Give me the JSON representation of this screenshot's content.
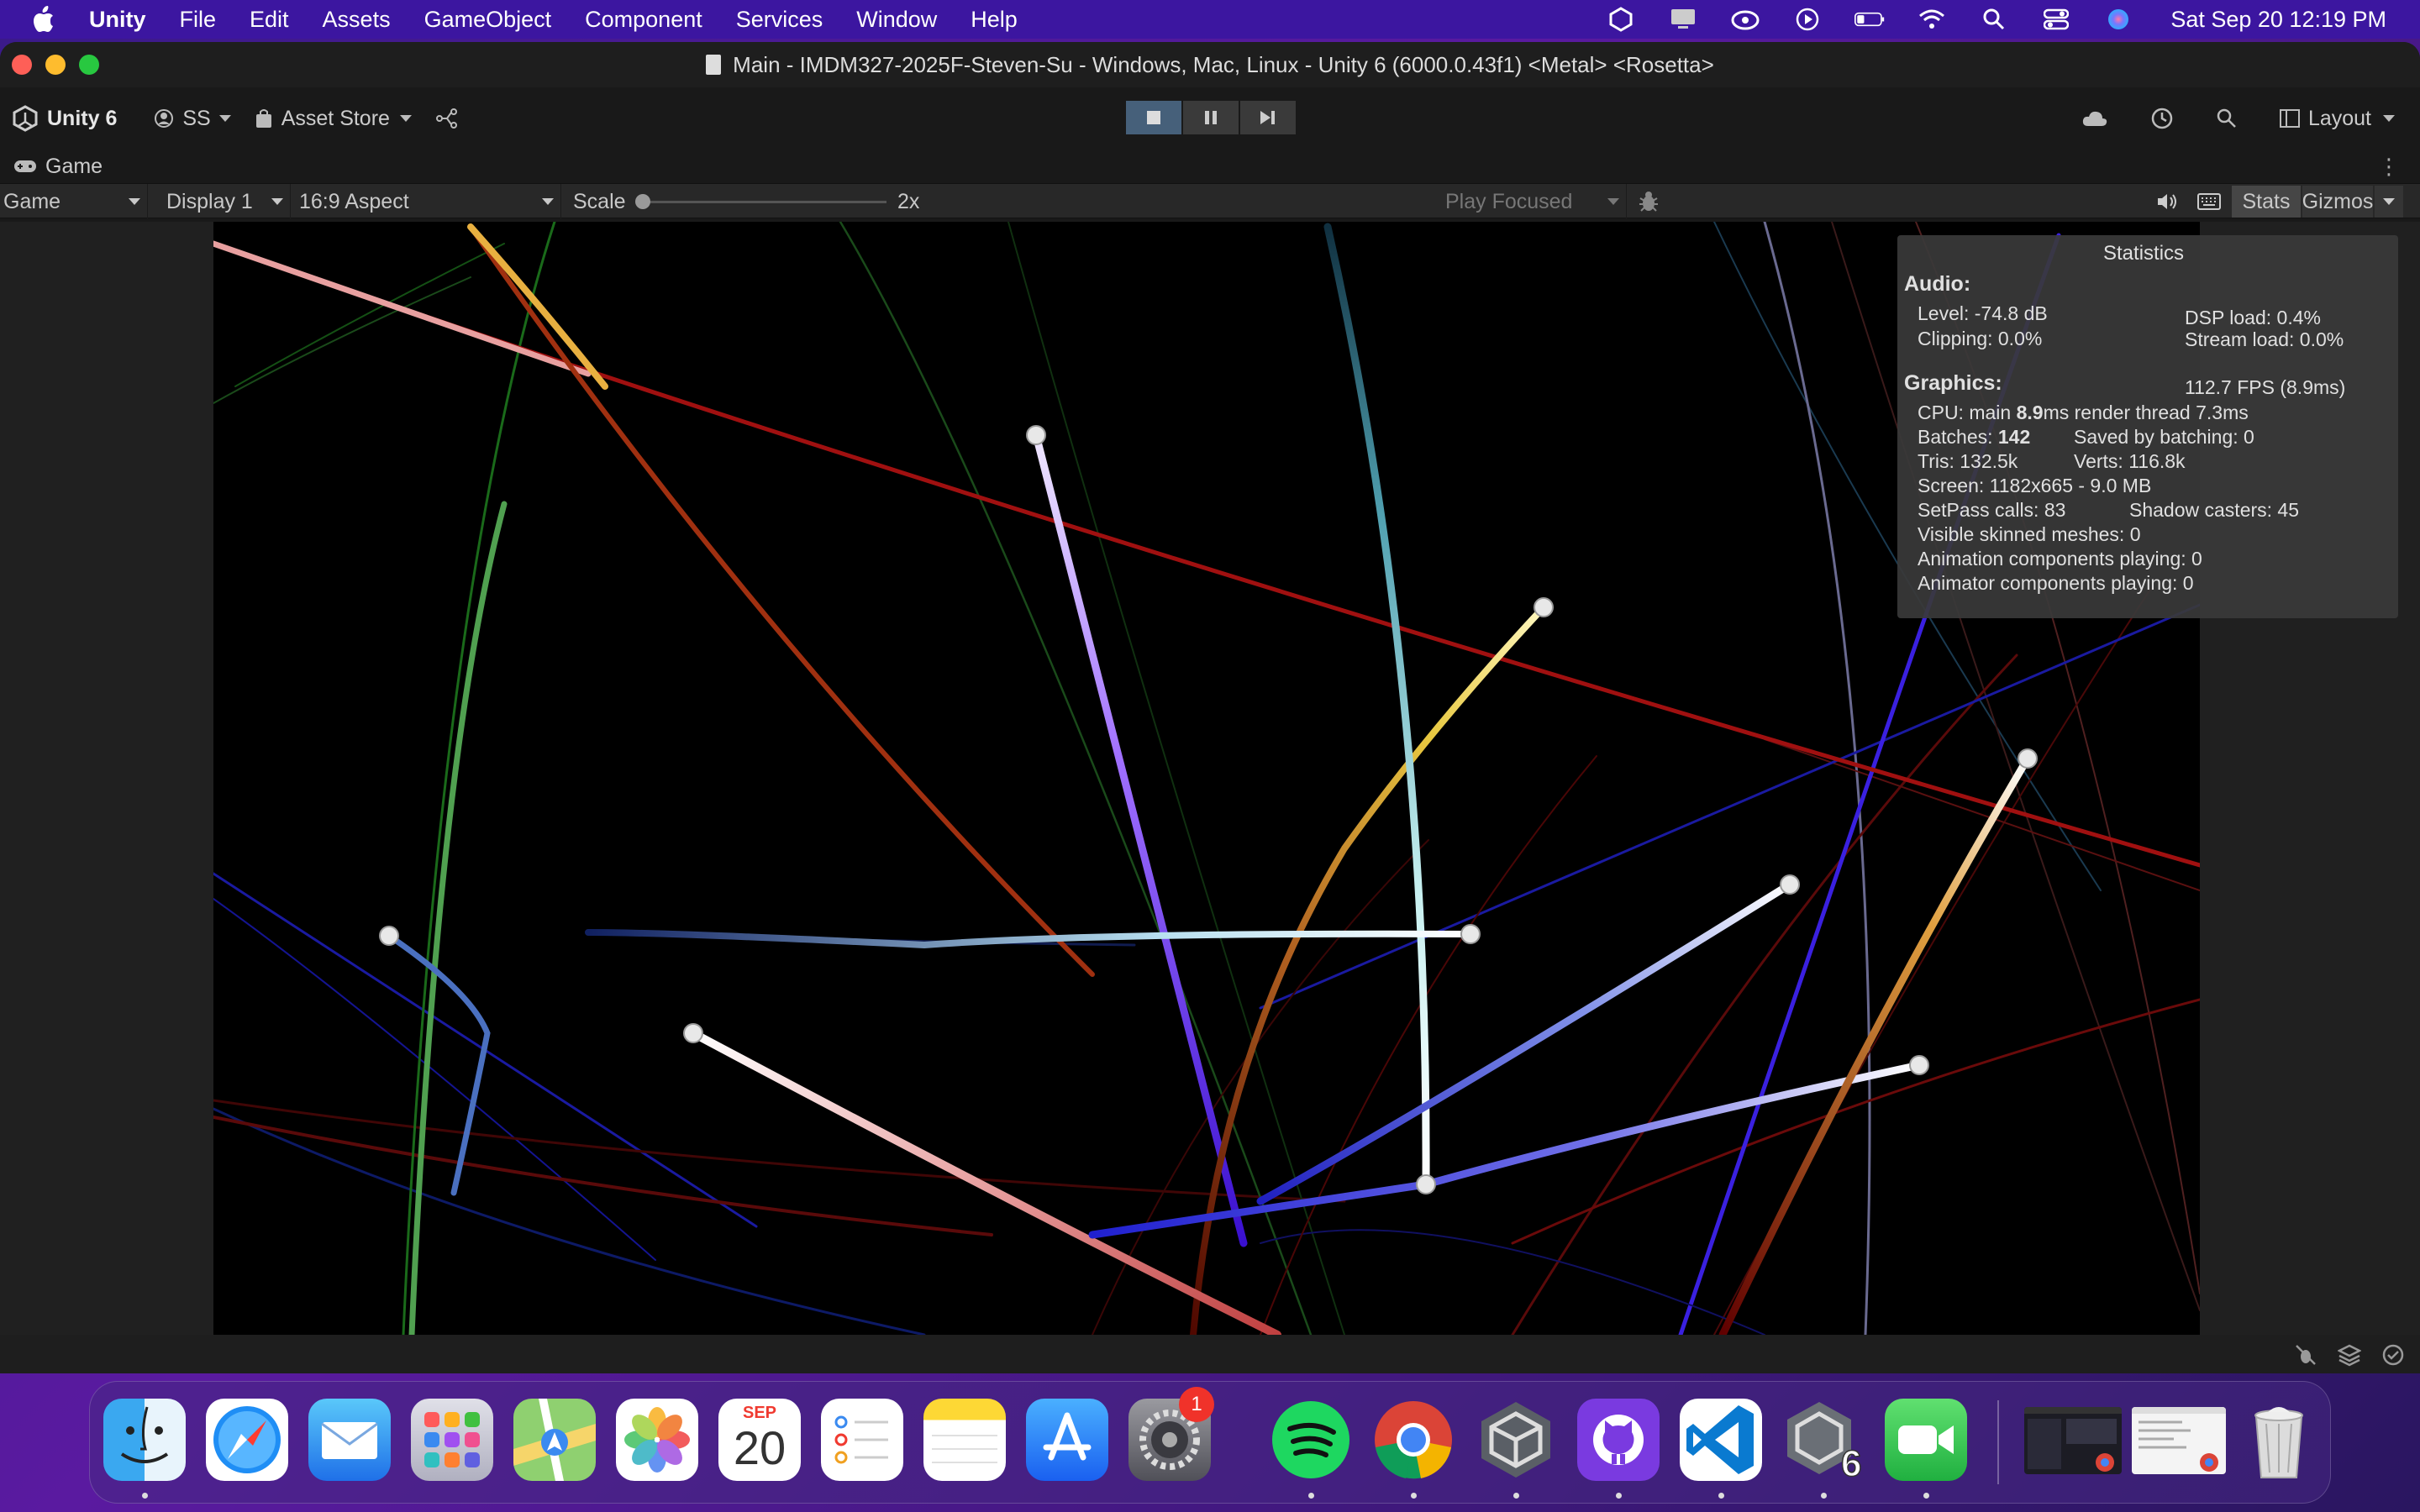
{
  "menubar": {
    "app": "Unity",
    "items": [
      "File",
      "Edit",
      "Assets",
      "GameObject",
      "Component",
      "Services",
      "Window",
      "Help"
    ],
    "clock": "Sat Sep 20  12:19 PM"
  },
  "window": {
    "title": "Main - IMDM327-2025F-Steven-Su - Windows, Mac, Linux - Unity 6 (6000.0.43f1) <Metal> <Rosetta>"
  },
  "toolbar": {
    "unity_version": "Unity 6",
    "account": "SS",
    "asset_store": "Asset Store",
    "layout": "Layout"
  },
  "tab": {
    "label": "Game"
  },
  "gamebar": {
    "mode": "Game",
    "display": "Display 1",
    "aspect": "16:9 Aspect",
    "scale_label": "Scale",
    "scale_value": "2x",
    "play_focused": "Play Focused",
    "stats": "Stats",
    "gizmos": "Gizmos"
  },
  "stats": {
    "title": "Statistics",
    "audio_header": "Audio:",
    "level": "Level: -74.8 dB",
    "clipping": "Clipping: 0.0%",
    "dsp_load": "DSP load: 0.4%",
    "stream_load": "Stream load: 0.0%",
    "graphics_header": "Graphics:",
    "fps": "112.7 FPS (8.9ms)",
    "cpu_prefix": "CPU: main ",
    "cpu_main": "8.9",
    "cpu_suffix": "ms  render thread 7.3ms",
    "batches_prefix": "Batches: ",
    "batches": "142",
    "saved_batching": "Saved by batching: 0",
    "tris": "Tris: 132.5k",
    "verts": "Verts: 116.8k",
    "screen": "Screen: 1182x665 - 9.0 MB",
    "setpass": "SetPass calls: 83",
    "shadow_casters": "Shadow casters: 45",
    "skinned": "Visible skinned meshes: 0",
    "anim_components": "Animation components playing: 0",
    "animator_components": "Animator components playing: 0"
  },
  "dock": {
    "calendar_month": "SEP",
    "calendar_day": "20",
    "settings_badge": "1",
    "apps": [
      "Finder",
      "Safari",
      "Mail",
      "Launchpad",
      "Maps",
      "Photos",
      "Calendar",
      "Reminders",
      "Notes",
      "App Store",
      "System Settings",
      "Spotify",
      "Google Chrome",
      "Unity Hub",
      "GitHub Desktop",
      "Visual Studio Code",
      "Unity 6",
      "FaceTime",
      "Chrome Window",
      "Chrome Window",
      "Trash"
    ]
  }
}
